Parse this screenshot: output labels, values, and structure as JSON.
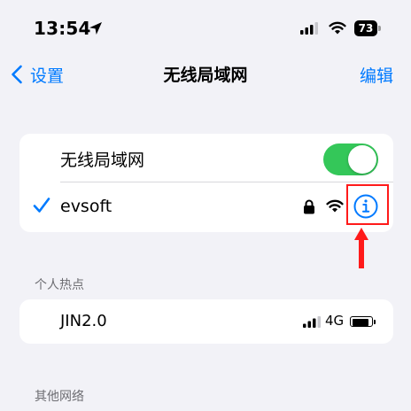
{
  "status_bar": {
    "time": "13:54",
    "battery_level": "73"
  },
  "nav": {
    "back_label": "设置",
    "title": "无线局域网",
    "edit_label": "编辑"
  },
  "wifi_section": {
    "toggle_label": "无线局域网",
    "toggle_on": true,
    "connected_network": "evsoft"
  },
  "hotspot_section": {
    "header": "个人热点",
    "device_name": "JIN2.0",
    "network_type": "4G"
  },
  "other_section": {
    "header": "其他网络"
  },
  "colors": {
    "accent": "#007aff",
    "toggle_on": "#34c759",
    "annotation": "#ff1a1a",
    "background": "#f2f2f7"
  }
}
